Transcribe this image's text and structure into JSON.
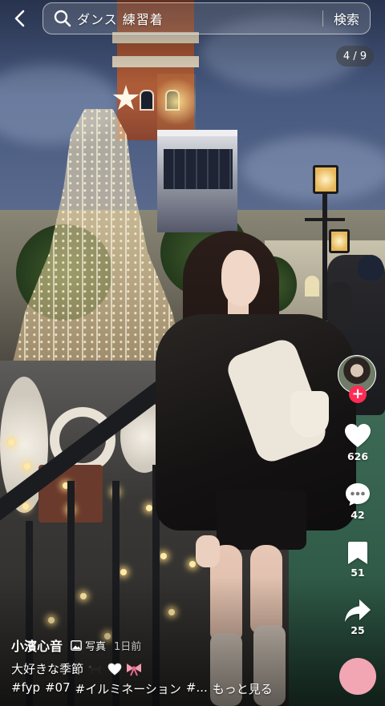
{
  "header": {
    "back_icon": "chevron-left-icon",
    "search_icon": "search-icon",
    "search_query": "ダンス 練習着",
    "search_button_label": "検索"
  },
  "counter": {
    "label": "4 / 9"
  },
  "sidebar": {
    "avatar_name": "avatar",
    "follow_label": "+",
    "like_count": "626",
    "comment_count": "42",
    "save_count": "51",
    "share_count": "25",
    "like_icon": "heart-icon",
    "comment_icon": "comment-icon",
    "save_icon": "bookmark-icon",
    "share_icon": "share-arrow-icon"
  },
  "post": {
    "username": "小濱心音",
    "type_label": "写真",
    "time_ago": "1日前",
    "caption": "大好きな季節",
    "hashtags": [
      "#fyp",
      "#07",
      "#イルミネーション",
      "#..."
    ],
    "more_label": "もっと見る"
  },
  "colors": {
    "follow_button": "#fe2c55",
    "fab": "#f2a6b3",
    "counter_bg": "#3c3c3c"
  }
}
